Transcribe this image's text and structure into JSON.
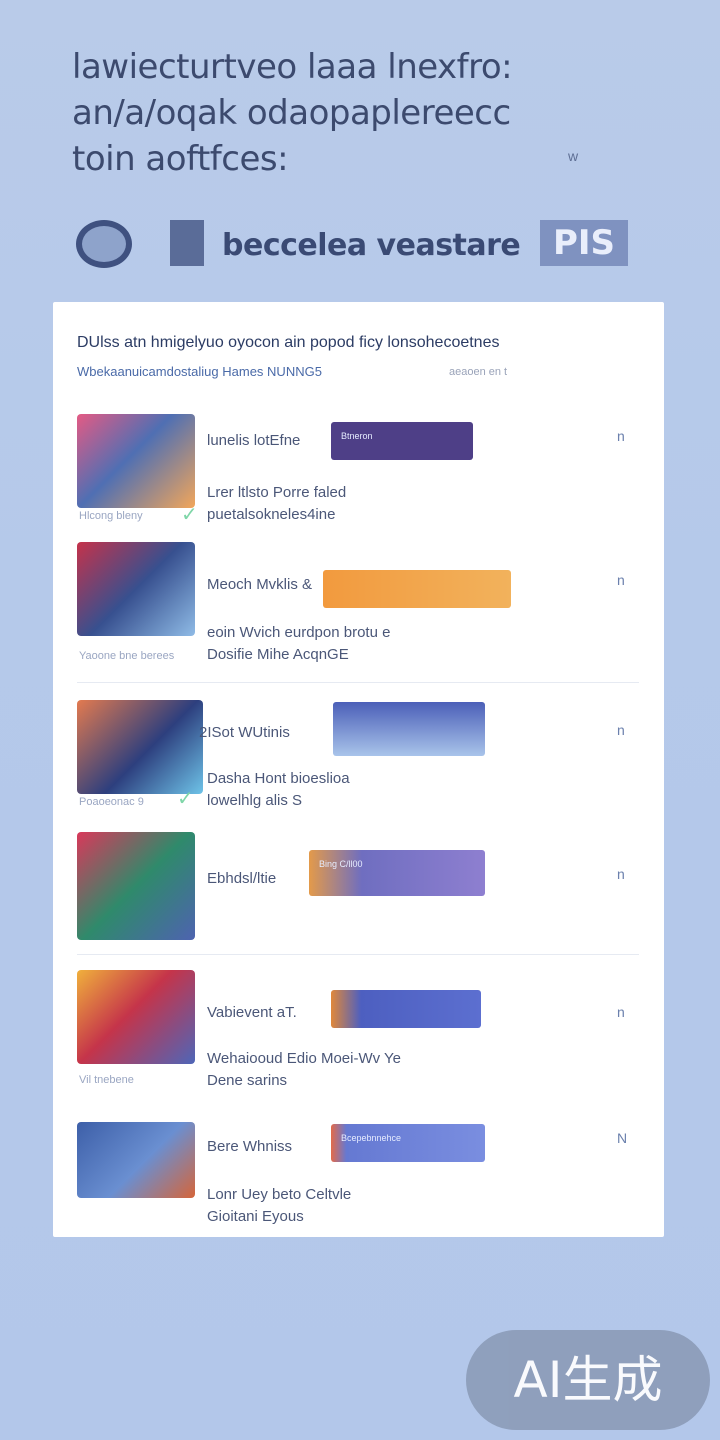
{
  "headline": "lawiecturtveo laaa lnexfro:\nan/a/oqak odaopaplereecc\ntoin aoftfces:",
  "headline_mark": "w",
  "subtitle": {
    "title": "beccelea veastare",
    "badge": "PIS"
  },
  "card": {
    "header": "DUlss atn hmigelyuo oyocon ain popod ficy lonsohecoetnes",
    "subheader": "Wbekaanuicamdostaliug Hames NUNNG5",
    "meta": "aeaoen en t",
    "items": [
      {
        "title": "lunelis lotEfne",
        "banner": "Btneron",
        "line1": "Lrer ltlsto Porre faled",
        "line2": "puetalsokneles4ine",
        "caption": "Hlcong bleny",
        "chevron": "n",
        "colors": [
          "#e45a84",
          "#4f6fb3",
          "#f2a65a"
        ],
        "banner_color": "#4e3f87"
      },
      {
        "title": "Meoch Mvklis &",
        "banner": "",
        "line1": "eoin Wvich eurdpon brotu e",
        "line2": "Dosifie Mihe AcqnGE",
        "caption": "Yaoone bne berees",
        "chevron": "n",
        "colors": [
          "#c5324a",
          "#37508f",
          "#8fbbe6"
        ],
        "banner_color": "#f29a3e"
      },
      {
        "title": "2ISot WUtinis",
        "banner": "",
        "line1": "Dasha Hont bioeslioa",
        "line2": "lowelhlg alis S",
        "caption": "Poaoeonac 9",
        "chevron": "n",
        "colors": [
          "#e37a4f",
          "#2d3f7e",
          "#6ec3e8"
        ],
        "banner_color": "#4b5fb8"
      },
      {
        "title": "Ebhdsl/ltie",
        "banner": "Bing C/ll00",
        "line1": "",
        "line2": "",
        "caption": "",
        "chevron": "n",
        "colors": [
          "#d9385a",
          "#2f8a6b",
          "#4e63b0"
        ],
        "banner_color": "#6f6ec0"
      },
      {
        "title": "Vabievent aT.",
        "banner": "",
        "line1": "Wehaiooud Edio Moei-Wv Ye",
        "line2": "Dene sarins",
        "caption": "Vil tnebene",
        "chevron": "n",
        "colors": [
          "#f0b03c",
          "#c5344a",
          "#4e66b8"
        ],
        "banner_color": "#4d5fc0"
      },
      {
        "title": "Bere Whniss",
        "banner": "Bcepebnnehce",
        "line1": "Lonr Uey beto Celtvle",
        "line2": "Gioitani Eyous",
        "caption": "",
        "chevron": "N",
        "colors": [
          "#3d5fa8",
          "#6a8fd1",
          "#d5653a"
        ],
        "banner_color": "#6579d2"
      }
    ]
  },
  "watermark": "AI生成"
}
